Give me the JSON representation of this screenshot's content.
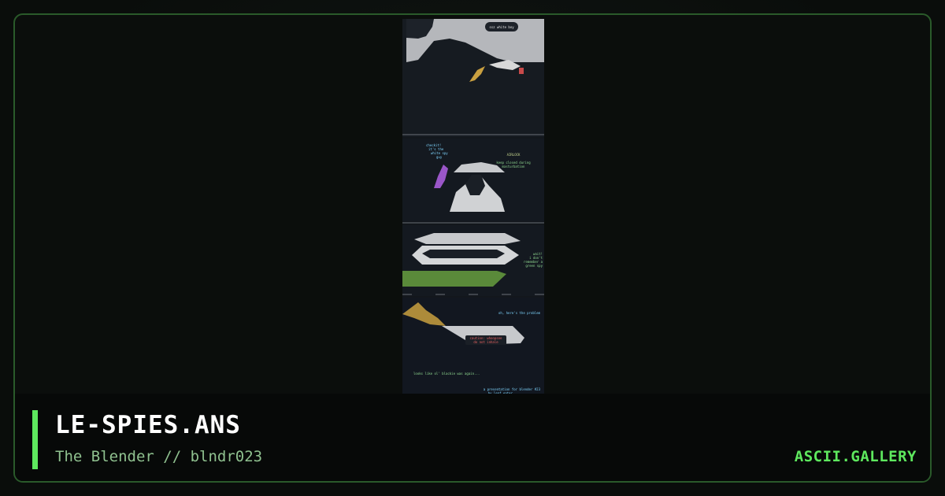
{
  "artwork": {
    "title": "LE-SPIES.ANS",
    "byline": "The Blender // blndr023",
    "panel_texts": {
      "white_boy": "ssz white boy",
      "checkit": [
        "checkit!",
        "it's the",
        "white spy",
        "guy"
      ],
      "airlock_title": "AIRLOCK",
      "airlock_notice": [
        "keep closed during",
        "masturbation"
      ],
      "wait": [
        "wait!",
        "i don't",
        "remember a",
        "green spy"
      ],
      "problem": "oh, here's the problem",
      "caution": [
        "caution: whoopsee",
        "do not inhale"
      ],
      "blackie": "looks like ol' blackie was again...",
      "credit": [
        "a presentation for blender #23",
        "by leaf eater"
      ]
    }
  },
  "site": {
    "brand": "ASCII.GALLERY"
  },
  "colors": {
    "accent": "#5ee85e",
    "border": "#2a5a2a",
    "background": "#0a0d0b",
    "subtitle": "#8fc18f"
  }
}
